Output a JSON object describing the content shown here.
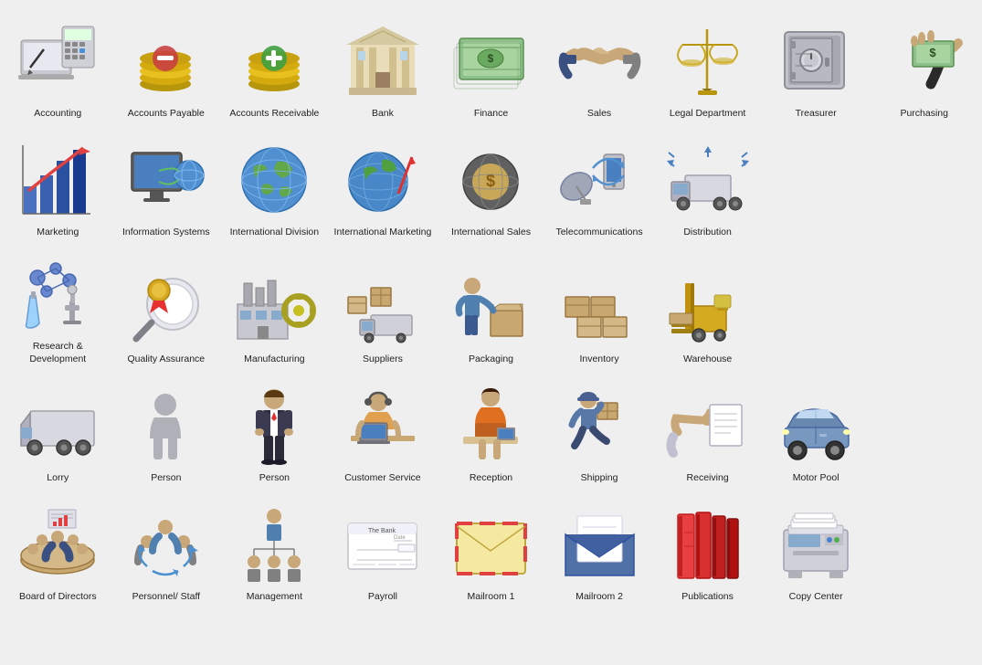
{
  "items": [
    {
      "id": "accounting",
      "label": "Accounting",
      "row": 1,
      "icon": "accounting"
    },
    {
      "id": "accounts-payable",
      "label": "Accounts Payable",
      "row": 1,
      "icon": "accounts-payable"
    },
    {
      "id": "accounts-receivable",
      "label": "Accounts Receivable",
      "row": 1,
      "icon": "accounts-receivable"
    },
    {
      "id": "bank",
      "label": "Bank",
      "row": 1,
      "icon": "bank"
    },
    {
      "id": "finance",
      "label": "Finance",
      "row": 1,
      "icon": "finance"
    },
    {
      "id": "sales",
      "label": "Sales",
      "row": 1,
      "icon": "sales"
    },
    {
      "id": "legal-department",
      "label": "Legal Department",
      "row": 1,
      "icon": "legal"
    },
    {
      "id": "treasurer",
      "label": "Treasurer",
      "row": 1,
      "icon": "treasurer"
    },
    {
      "id": "purchasing",
      "label": "Purchasing",
      "row": 1,
      "icon": "purchasing"
    },
    {
      "id": "marketing",
      "label": "Marketing",
      "row": 2,
      "icon": "marketing"
    },
    {
      "id": "information-systems",
      "label": "Information Systems",
      "row": 2,
      "icon": "info-systems"
    },
    {
      "id": "international-division",
      "label": "International Division",
      "row": 2,
      "icon": "intl-division"
    },
    {
      "id": "international-marketing",
      "label": "International Marketing",
      "row": 2,
      "icon": "intl-marketing"
    },
    {
      "id": "international-sales",
      "label": "International Sales",
      "row": 2,
      "icon": "intl-sales"
    },
    {
      "id": "telecommunications",
      "label": "Telecommunications",
      "row": 2,
      "icon": "telecom"
    },
    {
      "id": "distribution",
      "label": "Distribution",
      "row": 2,
      "icon": "distribution"
    },
    {
      "id": "research-development",
      "label": "Research & Development",
      "row": 3,
      "icon": "r-and-d"
    },
    {
      "id": "quality-assurance",
      "label": "Quality Assurance",
      "row": 3,
      "icon": "quality"
    },
    {
      "id": "manufacturing",
      "label": "Manufacturing",
      "row": 3,
      "icon": "manufacturing"
    },
    {
      "id": "suppliers",
      "label": "Suppliers",
      "row": 3,
      "icon": "suppliers"
    },
    {
      "id": "packaging",
      "label": "Packaging",
      "row": 3,
      "icon": "packaging"
    },
    {
      "id": "inventory",
      "label": "Inventory",
      "row": 3,
      "icon": "inventory"
    },
    {
      "id": "warehouse",
      "label": "Warehouse",
      "row": 3,
      "icon": "warehouse"
    },
    {
      "id": "lorry",
      "label": "Lorry",
      "row": 4,
      "icon": "lorry"
    },
    {
      "id": "person1",
      "label": "Person",
      "row": 4,
      "icon": "person1"
    },
    {
      "id": "person2",
      "label": "Person",
      "row": 4,
      "icon": "person2"
    },
    {
      "id": "customer-service",
      "label": "Customer Service",
      "row": 4,
      "icon": "customer-service"
    },
    {
      "id": "reception",
      "label": "Reception",
      "row": 4,
      "icon": "reception"
    },
    {
      "id": "shipping",
      "label": "Shipping",
      "row": 4,
      "icon": "shipping"
    },
    {
      "id": "receiving",
      "label": "Receiving",
      "row": 4,
      "icon": "receiving"
    },
    {
      "id": "motor-pool",
      "label": "Motor Pool",
      "row": 4,
      "icon": "motor-pool"
    },
    {
      "id": "board-of-directors",
      "label": "Board of Directors",
      "row": 5,
      "icon": "board"
    },
    {
      "id": "personnel-staff",
      "label": "Personnel/ Staff",
      "row": 5,
      "icon": "personnel"
    },
    {
      "id": "management",
      "label": "Management",
      "row": 5,
      "icon": "management"
    },
    {
      "id": "payroll",
      "label": "Payroll",
      "row": 5,
      "icon": "payroll"
    },
    {
      "id": "mailroom1",
      "label": "Mailroom 1",
      "row": 5,
      "icon": "mailroom1"
    },
    {
      "id": "mailroom2",
      "label": "Mailroom 2",
      "row": 5,
      "icon": "mailroom2"
    },
    {
      "id": "publications",
      "label": "Publications",
      "row": 5,
      "icon": "publications"
    },
    {
      "id": "copy-center",
      "label": "Copy Center",
      "row": 5,
      "icon": "copy-center"
    }
  ]
}
